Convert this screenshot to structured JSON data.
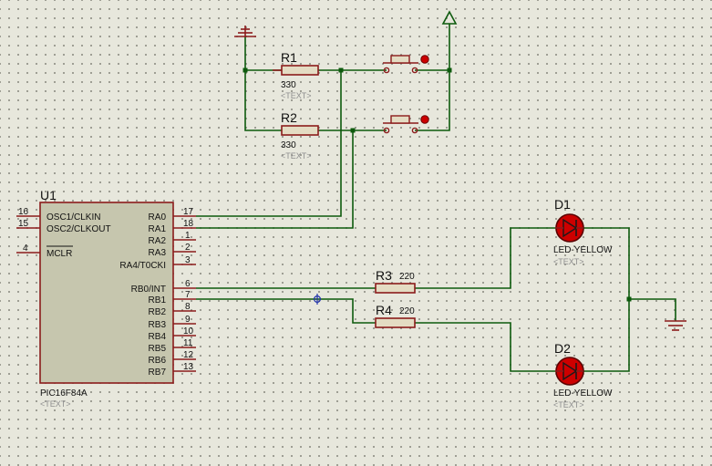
{
  "components": {
    "u1": {
      "ref": "U1",
      "part": "PIC16F84A",
      "text": "<TEXT>",
      "left_pins": [
        {
          "num": "16",
          "name": "OSC1/CLKIN"
        },
        {
          "num": "15",
          "name": "OSC2/CLKOUT"
        },
        {
          "num": "4",
          "name": "MCLR"
        }
      ],
      "right_pins": [
        {
          "num": "17",
          "name": "RA0"
        },
        {
          "num": "18",
          "name": "RA1"
        },
        {
          "num": "1",
          "name": "RA2"
        },
        {
          "num": "2",
          "name": "RA3"
        },
        {
          "num": "3",
          "name": "RA4/T0CKI"
        },
        {
          "num": "6",
          "name": "RB0/INT"
        },
        {
          "num": "7",
          "name": "RB1"
        },
        {
          "num": "8",
          "name": "RB2"
        },
        {
          "num": "9",
          "name": "RB3"
        },
        {
          "num": "10",
          "name": "RB4"
        },
        {
          "num": "11",
          "name": "RB5"
        },
        {
          "num": "12",
          "name": "RB6"
        },
        {
          "num": "13",
          "name": "RB7"
        }
      ]
    },
    "r1": {
      "ref": "R1",
      "value": "330",
      "text": "<TEXT>"
    },
    "r2": {
      "ref": "R2",
      "value": "330",
      "text": "<TEXT>"
    },
    "r3": {
      "ref": "R3",
      "value": "220"
    },
    "r4": {
      "ref": "R4",
      "value": "220"
    },
    "d1": {
      "ref": "D1",
      "value": "LED-YELLOW",
      "text": "<TEXT>"
    },
    "d2": {
      "ref": "D2",
      "value": "LED-YELLOW",
      "text": "<TEXT>"
    }
  },
  "colors": {
    "wire": "#0d5a0d",
    "part": "#8b1b1b",
    "led_fill": "#cc0000",
    "chip_fill": "#c6c6ae",
    "background": "#e7e7dc"
  }
}
